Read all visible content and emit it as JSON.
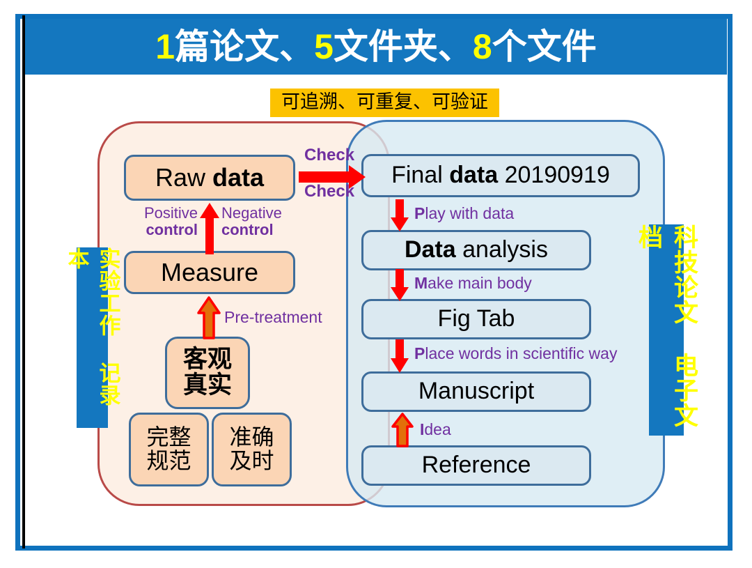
{
  "title": {
    "full": "1篇论文、5文件夹、8个文件",
    "parts": [
      {
        "text": "1",
        "highlight": true
      },
      {
        "text": "篇论文、",
        "highlight": false
      },
      {
        "text": "5",
        "highlight": true
      },
      {
        "text": "文件夹、",
        "highlight": false
      },
      {
        "text": "8",
        "highlight": true
      },
      {
        "text": "个文件",
        "highlight": false
      }
    ],
    "bg_color": "#1477bf",
    "text_color": "#ffffff",
    "number_color": "#ffff00"
  },
  "badge": {
    "label": "可追溯、可重复、可验证",
    "bg_color": "#fcc200",
    "text_color": "#000000"
  },
  "side_tabs": {
    "left": {
      "label": "实验工作 记录本",
      "bg_color": "#1477bf",
      "text_color": "#ffff00"
    },
    "right": {
      "label": "科技论文 电子文档",
      "bg_color": "#1477bf",
      "text_color": "#ffff00"
    }
  },
  "panels": {
    "left": {
      "border_color": "#b94a48",
      "fill_color": "#fdf0e6"
    },
    "right": {
      "border_color": "#3f7bb8",
      "fill_color": "#d7eaf3"
    }
  },
  "left_flow": {
    "nodes": [
      {
        "id": "raw-data",
        "text_plain": "Raw data",
        "lead": "Raw ",
        "bold": "data",
        "tail": ""
      },
      {
        "id": "measure",
        "text_plain": "Measure",
        "lead": "Measure",
        "bold": "",
        "tail": ""
      },
      {
        "id": "objective",
        "line1": "客观",
        "line2": "真实"
      },
      {
        "id": "complete",
        "line1": "完整",
        "line2": "规范"
      },
      {
        "id": "accurate",
        "line1": "准确",
        "line2": "及时"
      }
    ],
    "arrow_labels": {
      "positive_top": "Positive",
      "positive_bottom": "control",
      "negative_top": "Negative",
      "negative_bottom": "control",
      "pretreatment": "Pre-treatment",
      "check_top": "Check",
      "check_bottom": "Check"
    }
  },
  "right_flow": {
    "nodes": [
      {
        "id": "final-data",
        "lead": "Final ",
        "bold": "data",
        "tail": " 20190919"
      },
      {
        "id": "analysis",
        "lead": "",
        "bold": "Data",
        "tail": " analysis"
      },
      {
        "id": "figtab",
        "lead": "Fig Tab",
        "bold": "",
        "tail": ""
      },
      {
        "id": "manuscript",
        "lead": "Manuscript",
        "bold": "",
        "tail": ""
      },
      {
        "id": "reference",
        "lead": "Reference",
        "bold": "",
        "tail": ""
      }
    ],
    "arrow_labels": {
      "play": {
        "cap": "P",
        "rest": "lay with data"
      },
      "make": {
        "cap": "M",
        "rest": "ake main body"
      },
      "place": {
        "cap": "P",
        "rest": "lace words in scientific way"
      },
      "idea": {
        "cap": "I",
        "rest": "dea"
      }
    }
  },
  "colors": {
    "node_peach": "#fbd5b5",
    "node_blue": "#dbe9f1",
    "node_border": "#3e6d9b",
    "arrow_red": "#ff0000",
    "arrow_orange": "#e2700a",
    "label_purple": "#7030a0",
    "frame_blue": "#0f72bd"
  }
}
